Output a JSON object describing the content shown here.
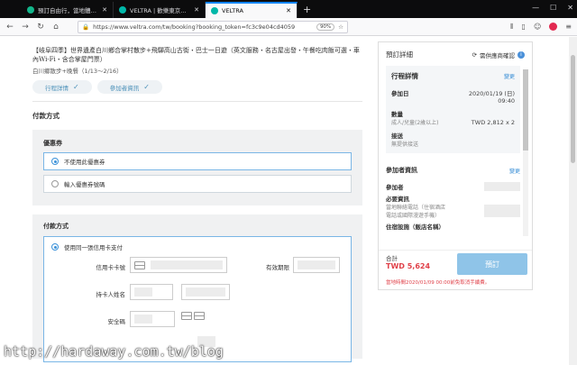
{
  "browser": {
    "tabs": [
      {
        "title": "預訂自由行，當地體驗以及觀光",
        "active": false
      },
      {
        "title": "VELTRA | 歡樂東京盛事 百顏玩樂",
        "active": false
      },
      {
        "title": "VELTRA",
        "active": true
      }
    ],
    "url": "https://www.veltra.com/tw/booking?booking_token=fc3c9e04cd4059",
    "zoom": "90%"
  },
  "tour": {
    "title": "【岐阜四季】世界遺產白川鄉合掌村散步+飛驒高山古街・巴士一日遊（英文服務・名古屋出發・午餐吃肉飯可選・車內Wi-Fi・含合掌屋門票）",
    "subtitle": "白川鄉散步+晚餐（1/13～2/16）",
    "pill_details": "行程詳情",
    "pill_participants": "參加者資訊"
  },
  "payment": {
    "section_title": "付款方式",
    "coupon": {
      "heading": "優惠券",
      "option_none": "不使用此優惠券",
      "option_code": "輸入優惠券號碼"
    },
    "method": {
      "heading": "付款方式",
      "option_card": "使用同一張信用卡支付",
      "card_number_label": "信用卡卡號",
      "expiry_label": "有效期限",
      "holder_label": "持卡人姓名",
      "cvv_label": "安全碼"
    }
  },
  "summary": {
    "title": "預訂詳細",
    "preference": "需供應商確認",
    "details_title": "行程詳情",
    "edit_label": "變更",
    "date_label": "參加日",
    "date_value": "2020/01/19 (日)",
    "time_value": "09:40",
    "quantity_label": "數量",
    "quantity_type": "成人/兒童(2歲以上)",
    "quantity_value": "TWD 2,812 x 2",
    "pickup_label": "接送",
    "pickup_value": "無提供接送",
    "participants_title": "參加者資訊",
    "participants_edit": "變更",
    "participant_label": "參加者",
    "required_label": "必要資訊",
    "required_note1": "當地聯絡電話（住宿酒店",
    "required_note2": "電話或國際漫遊手機）",
    "extra_label": "住宿設施（飯店名稱）",
    "total_label": "合計",
    "total_value": "TWD 5,624",
    "book_button": "預訂",
    "cancel_note": "當地時間2020/01/09 00:00前免取消手續費。"
  },
  "watermark": "http://hardaway.com.tw/blog"
}
